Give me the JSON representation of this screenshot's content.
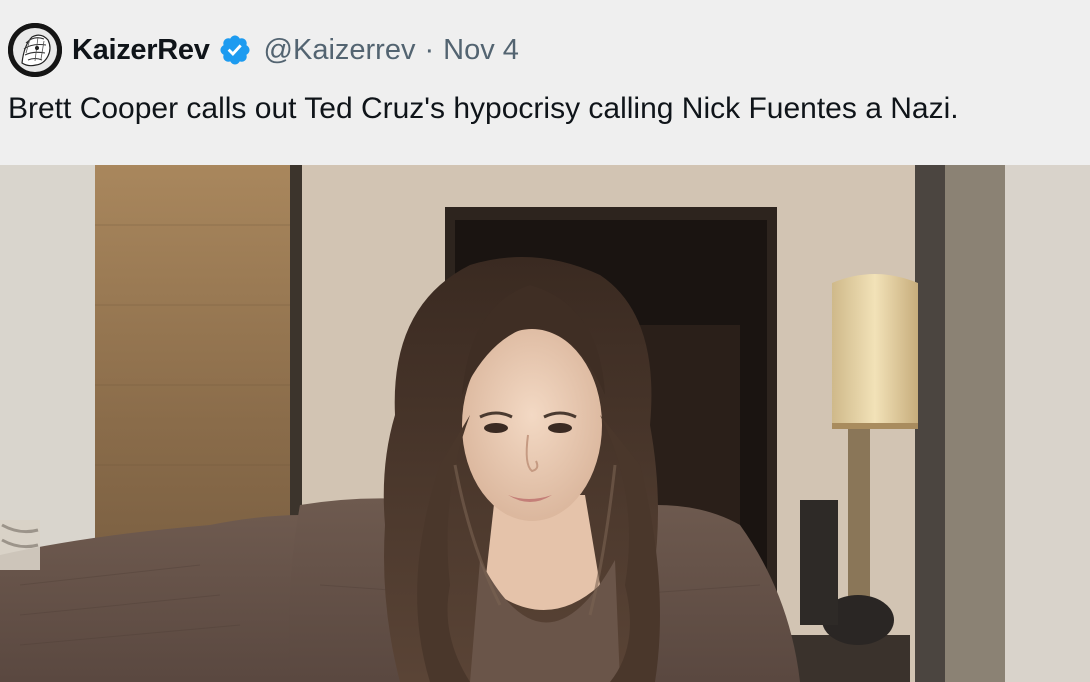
{
  "tweet": {
    "display_name": "KaizerRev",
    "handle": "@Kaizerrev",
    "separator": "·",
    "date": "Nov 4",
    "text": "Brett Cooper calls out Ted Cruz's hypocrisy calling Nick Fuentes a Nazi.",
    "verified": true
  },
  "icons": {
    "verified": "verified-badge-icon",
    "avatar": "profile-avatar"
  },
  "colors": {
    "background": "#efefef",
    "text_primary": "#0f1419",
    "text_secondary": "#536471",
    "verified_blue": "#1d9bf0"
  }
}
